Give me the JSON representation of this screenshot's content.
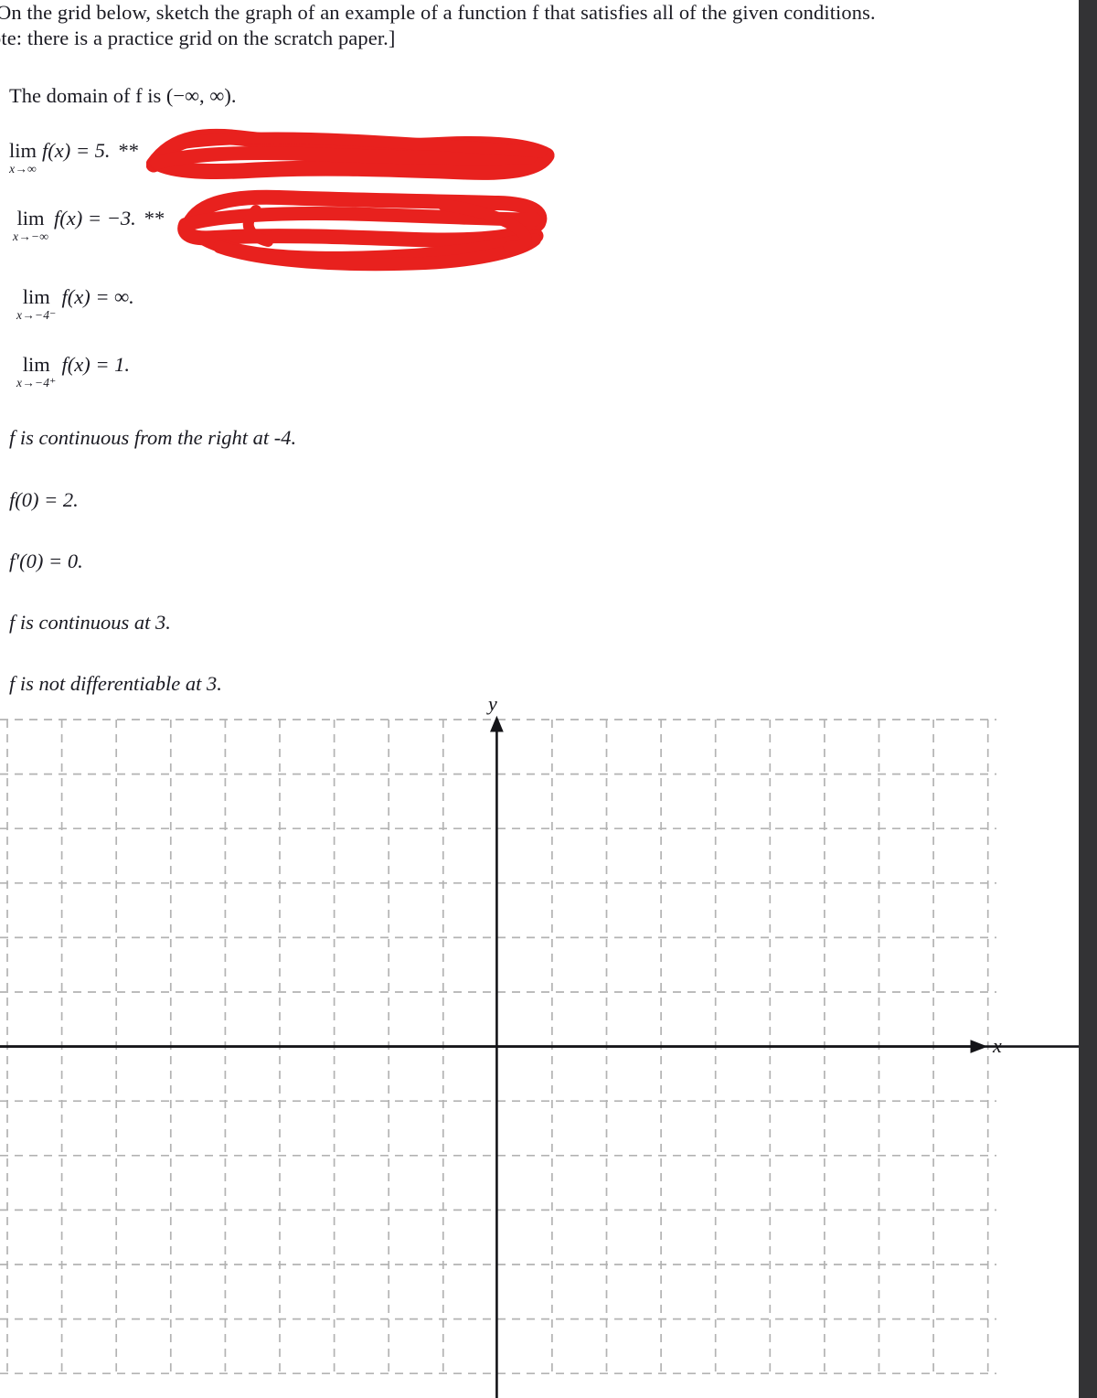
{
  "document": {
    "prompt_line_1": "On the grid below, sketch the graph of an example of a function f that satisfies all of the given conditions.",
    "prompt_line_2": "ote: there is a practice grid on the scratch paper.]",
    "domain_statement": "The domain of f is (−∞, ∞)."
  },
  "conditions": [
    {
      "id": "limit-plus-infinity",
      "lim_word": "lim",
      "lim_sub": "x→∞",
      "body": "f(x) = 5.",
      "annotation": "**",
      "redacted": true
    },
    {
      "id": "limit-minus-infinity",
      "lim_word": "lim",
      "lim_sub": "x→−∞",
      "body": "f(x) = −3.",
      "annotation": "**",
      "redacted": true
    },
    {
      "id": "limit-neg4-left",
      "lim_word": "lim",
      "lim_sub": "x→−4⁻",
      "body": "f(x) = ∞.",
      "annotation": "",
      "redacted": false
    },
    {
      "id": "limit-neg4-right",
      "lim_word": "lim",
      "lim_sub": "x→−4⁺",
      "body": "f(x) = 1.",
      "annotation": "",
      "redacted": false
    }
  ],
  "statements": [
    {
      "id": "continuous-right-neg4",
      "text": "f is continuous from the right at -4."
    },
    {
      "id": "f-of-zero",
      "text": "f(0) = 2."
    },
    {
      "id": "fprime-of-zero",
      "text": "f′(0) = 0."
    },
    {
      "id": "continuous-at-3",
      "text": "f is continuous at 3."
    },
    {
      "id": "not-differentiable-3",
      "text": "f is not differentiable at 3."
    }
  ],
  "graph": {
    "y_axis_label": "y",
    "x_axis_label": "x",
    "grid_color": "#b0b0b0",
    "axis_color": "#141418",
    "marker_color": "#e8211e"
  },
  "chart_data": {
    "type": "scatter",
    "title": "",
    "xlabel": "x",
    "ylabel": "y",
    "grid": true,
    "legend": null,
    "series": [],
    "x": [],
    "values": [],
    "note": "Empty coordinate grid provided for the student to sketch a graph on.",
    "grid_columns": 18,
    "grid_rows": 12,
    "origin_cell_from_left": 9,
    "origin_cell_from_top": 6
  }
}
